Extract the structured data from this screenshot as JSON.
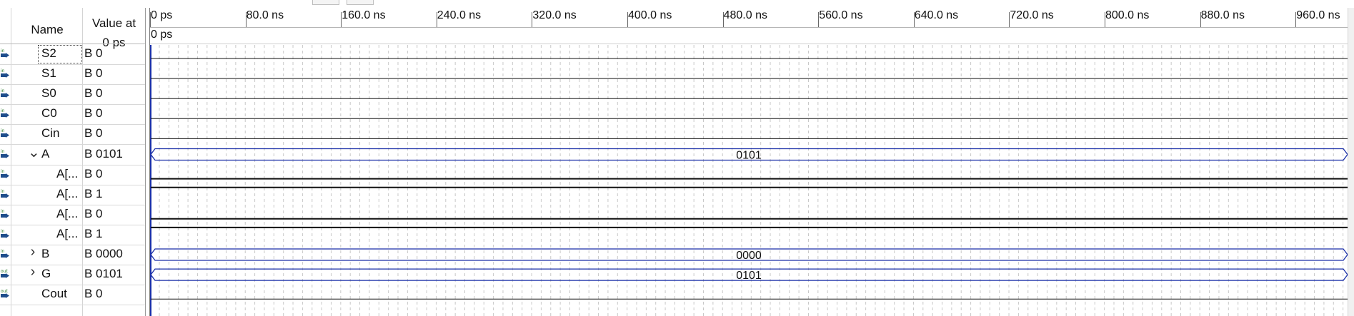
{
  "header": {
    "name_label": "Name",
    "value_label_line1": "Value at",
    "value_label_line2": "0 ps"
  },
  "ruler": {
    "ticks": [
      "0 ps",
      "80.0 ns",
      "160.0 ns",
      "240.0 ns",
      "320.0 ns",
      "400.0 ns",
      "480.0 ns",
      "560.0 ns",
      "640.0 ns",
      "720.0 ns",
      "800.0 ns",
      "880.0 ns",
      "960.0 ns"
    ],
    "cursor_label": "0 ps"
  },
  "signals": [
    {
      "name": "S2",
      "value": "B 0",
      "dir": "in",
      "kind": "bit",
      "level": 0,
      "indent": 0,
      "expander": ""
    },
    {
      "name": "S1",
      "value": "B 0",
      "dir": "in",
      "kind": "bit",
      "level": 0,
      "indent": 0,
      "expander": ""
    },
    {
      "name": "S0",
      "value": "B 0",
      "dir": "in",
      "kind": "bit",
      "level": 0,
      "indent": 0,
      "expander": ""
    },
    {
      "name": "C0",
      "value": "B 0",
      "dir": "in",
      "kind": "bit",
      "level": 0,
      "indent": 0,
      "expander": ""
    },
    {
      "name": "Cin",
      "value": "B 0",
      "dir": "in",
      "kind": "bit",
      "level": 0,
      "indent": 0,
      "expander": ""
    },
    {
      "name": "A",
      "value": "B 0101",
      "dir": "in",
      "kind": "bus",
      "bus_value": "0101",
      "indent": 0,
      "expander": "expanded"
    },
    {
      "name": "A[...",
      "value": "B 0",
      "dir": "in",
      "kind": "bit",
      "level": 0,
      "indent": 1,
      "expander": ""
    },
    {
      "name": "A[...",
      "value": "B 1",
      "dir": "in",
      "kind": "bit",
      "level": 1,
      "indent": 1,
      "expander": ""
    },
    {
      "name": "A[...",
      "value": "B 0",
      "dir": "in",
      "kind": "bit",
      "level": 0,
      "indent": 1,
      "expander": ""
    },
    {
      "name": "A[...",
      "value": "B 1",
      "dir": "in",
      "kind": "bit",
      "level": 1,
      "indent": 1,
      "expander": ""
    },
    {
      "name": "B",
      "value": "B 0000",
      "dir": "in",
      "kind": "bus",
      "bus_value": "0000",
      "indent": 0,
      "expander": "collapsed"
    },
    {
      "name": "G",
      "value": "B 0101",
      "dir": "out",
      "kind": "bus",
      "bus_value": "0101",
      "indent": 0,
      "expander": "collapsed"
    },
    {
      "name": "Cout",
      "value": "B 0",
      "dir": "out",
      "kind": "bit",
      "level": 0,
      "indent": 0,
      "expander": ""
    }
  ],
  "colors": {
    "bus_line": "#1a2fa8",
    "wave_line": "#111111",
    "grid": "#c8c8c8",
    "in_icon": "#1f4e8c",
    "out_icon": "#1f4e8c"
  },
  "icons": {
    "in_icon": "input-pin-icon",
    "out_icon": "output-pin-icon",
    "expanded": "chevron-down-icon",
    "collapsed": "chevron-right-icon"
  }
}
